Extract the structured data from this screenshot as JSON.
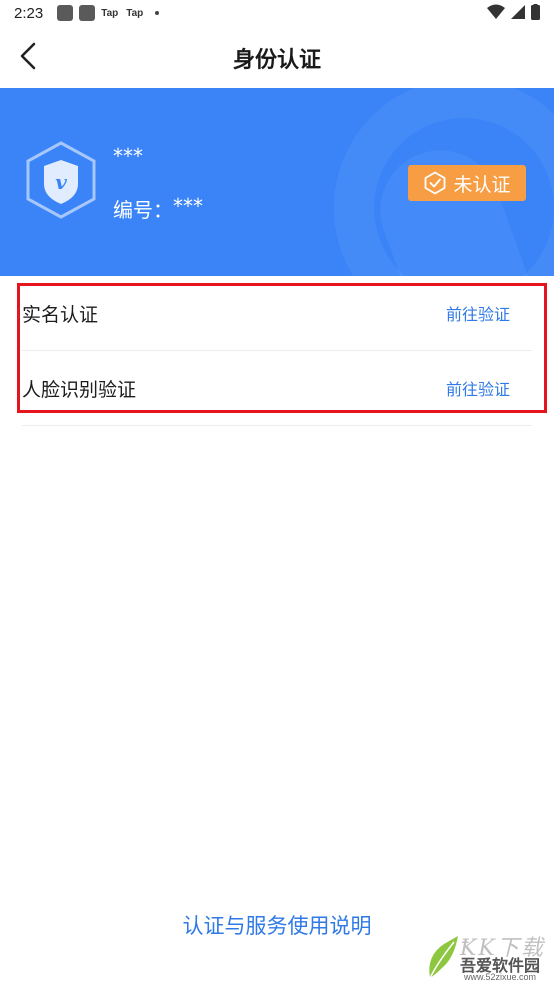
{
  "status_bar": {
    "time": "2:23",
    "notif_a": "Tap",
    "notif_b": "Tap"
  },
  "header": {
    "title": "身份认证",
    "back_icon": "chevron-left-icon"
  },
  "profile": {
    "name": "***",
    "id_label": "编号：",
    "id_value": "***",
    "badge_icon": "shield-v-icon",
    "status_label": "未认证",
    "status_icon": "hexagon-check-icon",
    "banner_color": "#3a84f8",
    "status_color": "#f79d44"
  },
  "verify_list": [
    {
      "label": "实名认证",
      "action": "前往验证"
    },
    {
      "label": "人脸识别验证",
      "action": "前往验证"
    }
  ],
  "footer": {
    "link": "认证与服务使用说明"
  },
  "watermark": {
    "main": "吾爱软件园",
    "url": "www.52zixue.com"
  },
  "accent_color": "#2f7ae6",
  "highlight_color": "#e5141f"
}
